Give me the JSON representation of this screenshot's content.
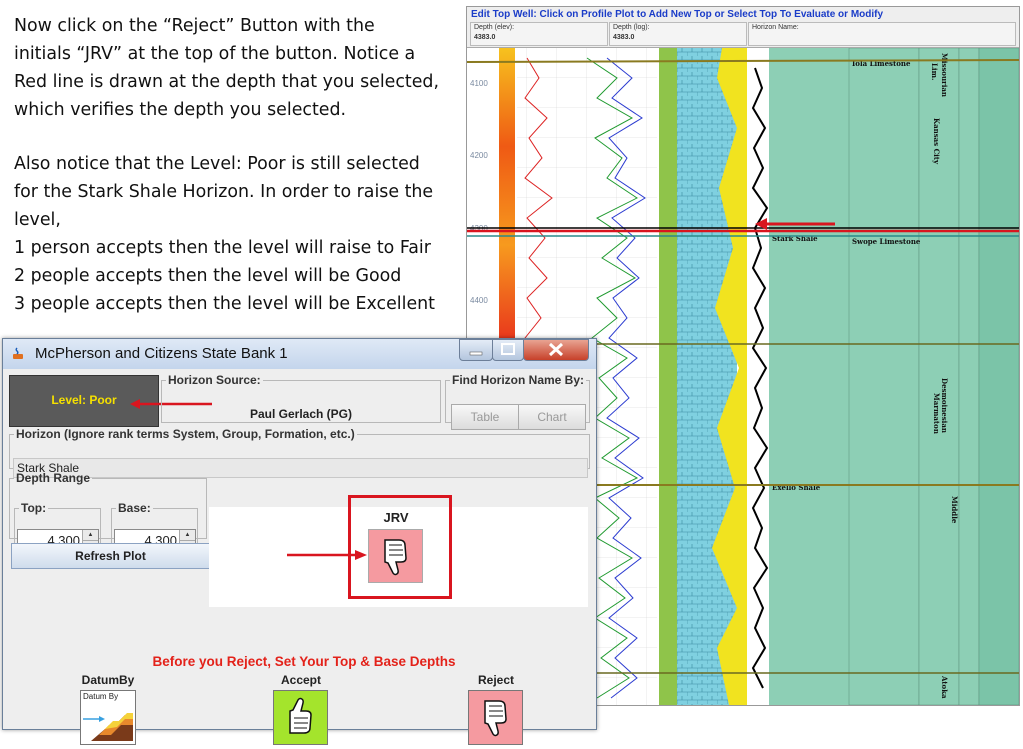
{
  "instructions": {
    "line1": "Now click on the “Reject” Button with the",
    "line2": "initials “JRV” at the top of the button.  Notice a",
    "line3": "Red line is drawn at the depth that you selected,",
    "line4": "which verifies the depth you selected.",
    "line5": "Also notice that the Level: Poor is still selected",
    "line6": "for the Stark Shale Horizon.  In order to raise the",
    "line7": "level,",
    "line8": "1 person accepts then the level will raise to Fair",
    "line9": "2 people accepts then the level will be Good",
    "line10": "3 people accepts then the level will be Excellent"
  },
  "plot": {
    "title": "Edit Top Well: Click on Profile Plot to Add New Top or Select Top To Evaluate or Modify",
    "depth_elev_label": "Depth (elev):",
    "depth_elev_value": "4383.0",
    "depth_log_label": "Depth (log):",
    "depth_log_value": "4383.0",
    "horizon_name_label": "Horizon Name:",
    "depth_ticks": [
      "4100",
      "4200",
      "4300",
      "4400"
    ],
    "tops": [
      "Iola Limestone",
      "Stark Shale",
      "Swope Limestone",
      "Exello Shale"
    ],
    "stages": [
      "Missourian",
      "Lim.",
      "Kansas City",
      "Desmoinesian",
      "Marmaton",
      "Middle",
      "Atoka"
    ]
  },
  "dialog": {
    "title": "McPherson and Citizens State Bank 1",
    "level": "Level: Poor",
    "horizon_source_legend": "Horizon Source:",
    "horizon_source_value": "Paul Gerlach (PG)",
    "find_by_legend": "Find Horizon Name By:",
    "table_btn": "Table",
    "chart_btn": "Chart",
    "horizon_legend": "Horizon (Ignore rank terms System, Group, Formation, etc.)",
    "horizon_value": "Stark Shale",
    "depth_range_legend": "Depth Range",
    "top_legend": "Top:",
    "top_value": "4,300",
    "base_legend": "Base:",
    "base_value": "4,300",
    "refresh_btn": "Refresh Plot",
    "user_initials": "JRV",
    "warning": "Before you Reject, Set Your Top & Base Depths",
    "datum_label": "DatumBy",
    "datum_icon_text": "Datum By",
    "accept_label": "Accept",
    "reject_label": "Reject"
  },
  "colors": {
    "highlight_red": "#d9151f",
    "level_text": "#f5e000",
    "accept_green": "#a4e42c",
    "reject_pink": "#f59aa0",
    "plot_title": "#1a3cc8"
  }
}
